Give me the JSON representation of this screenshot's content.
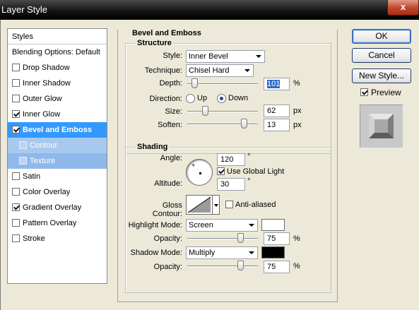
{
  "window": {
    "title": "Layer Style",
    "close_glyph": "x"
  },
  "styles_list": {
    "header": "Styles",
    "items": [
      {
        "label": "Blending Options: Default",
        "checkbox": false,
        "checked": false
      },
      {
        "label": "Drop Shadow",
        "checkbox": true,
        "checked": false
      },
      {
        "label": "Inner Shadow",
        "checkbox": true,
        "checked": false
      },
      {
        "label": "Outer Glow",
        "checkbox": true,
        "checked": false
      },
      {
        "label": "Inner Glow",
        "checkbox": true,
        "checked": true
      },
      {
        "label": "Bevel and Emboss",
        "checkbox": true,
        "checked": true,
        "selected": true
      },
      {
        "label": "Contour",
        "checkbox": true,
        "checked": false,
        "sub": true
      },
      {
        "label": "Texture",
        "checkbox": true,
        "checked": false,
        "sub": true
      },
      {
        "label": "Satin",
        "checkbox": true,
        "checked": false
      },
      {
        "label": "Color Overlay",
        "checkbox": true,
        "checked": false
      },
      {
        "label": "Gradient Overlay",
        "checkbox": true,
        "checked": true
      },
      {
        "label": "Pattern Overlay",
        "checkbox": true,
        "checked": false
      },
      {
        "label": "Stroke",
        "checkbox": true,
        "checked": false
      }
    ]
  },
  "panel": {
    "title": "Bevel and Emboss",
    "structure": {
      "title": "Structure",
      "style_label": "Style:",
      "style_value": "Inner Bevel",
      "technique_label": "Technique:",
      "technique_value": "Chisel Hard",
      "depth_label": "Depth:",
      "depth_value": "101",
      "depth_unit": "%",
      "depth_fraction": 0.1,
      "direction_label": "Direction:",
      "dir_up": "Up",
      "dir_down": "Down",
      "direction_selected": "Down",
      "size_label": "Size:",
      "size_value": "62",
      "size_unit": "px",
      "size_fraction": 0.25,
      "soften_label": "Soften:",
      "soften_value": "13",
      "soften_unit": "px",
      "soften_fraction": 0.8
    },
    "shading": {
      "title": "Shading",
      "angle_label": "Angle:",
      "angle_value": "120",
      "angle_unit": "°",
      "use_global_light": "Use Global Light",
      "use_global_light_checked": true,
      "altitude_label": "Altitude:",
      "altitude_value": "30",
      "altitude_unit": "°",
      "gloss_contour_label": "Gloss Contour:",
      "anti_aliased": "Anti-aliased",
      "anti_aliased_checked": false,
      "highlight_mode_label": "Highlight Mode:",
      "highlight_mode_value": "Screen",
      "highlight_color": "#ffffff",
      "highlight_opacity_label": "Opacity:",
      "highlight_opacity_value": "75",
      "highlight_opacity_unit": "%",
      "highlight_opacity_fraction": 0.75,
      "shadow_mode_label": "Shadow Mode:",
      "shadow_mode_value": "Multiply",
      "shadow_color": "#000000",
      "shadow_opacity_label": "Opacity:",
      "shadow_opacity_value": "75",
      "shadow_opacity_unit": "%",
      "shadow_opacity_fraction": 0.75
    }
  },
  "buttons": {
    "ok": "OK",
    "cancel": "Cancel",
    "new_style": "New Style...",
    "preview": "Preview",
    "preview_checked": true
  },
  "colors": {
    "selection": "#3399ff",
    "sub_item": "#a8c9ef"
  }
}
